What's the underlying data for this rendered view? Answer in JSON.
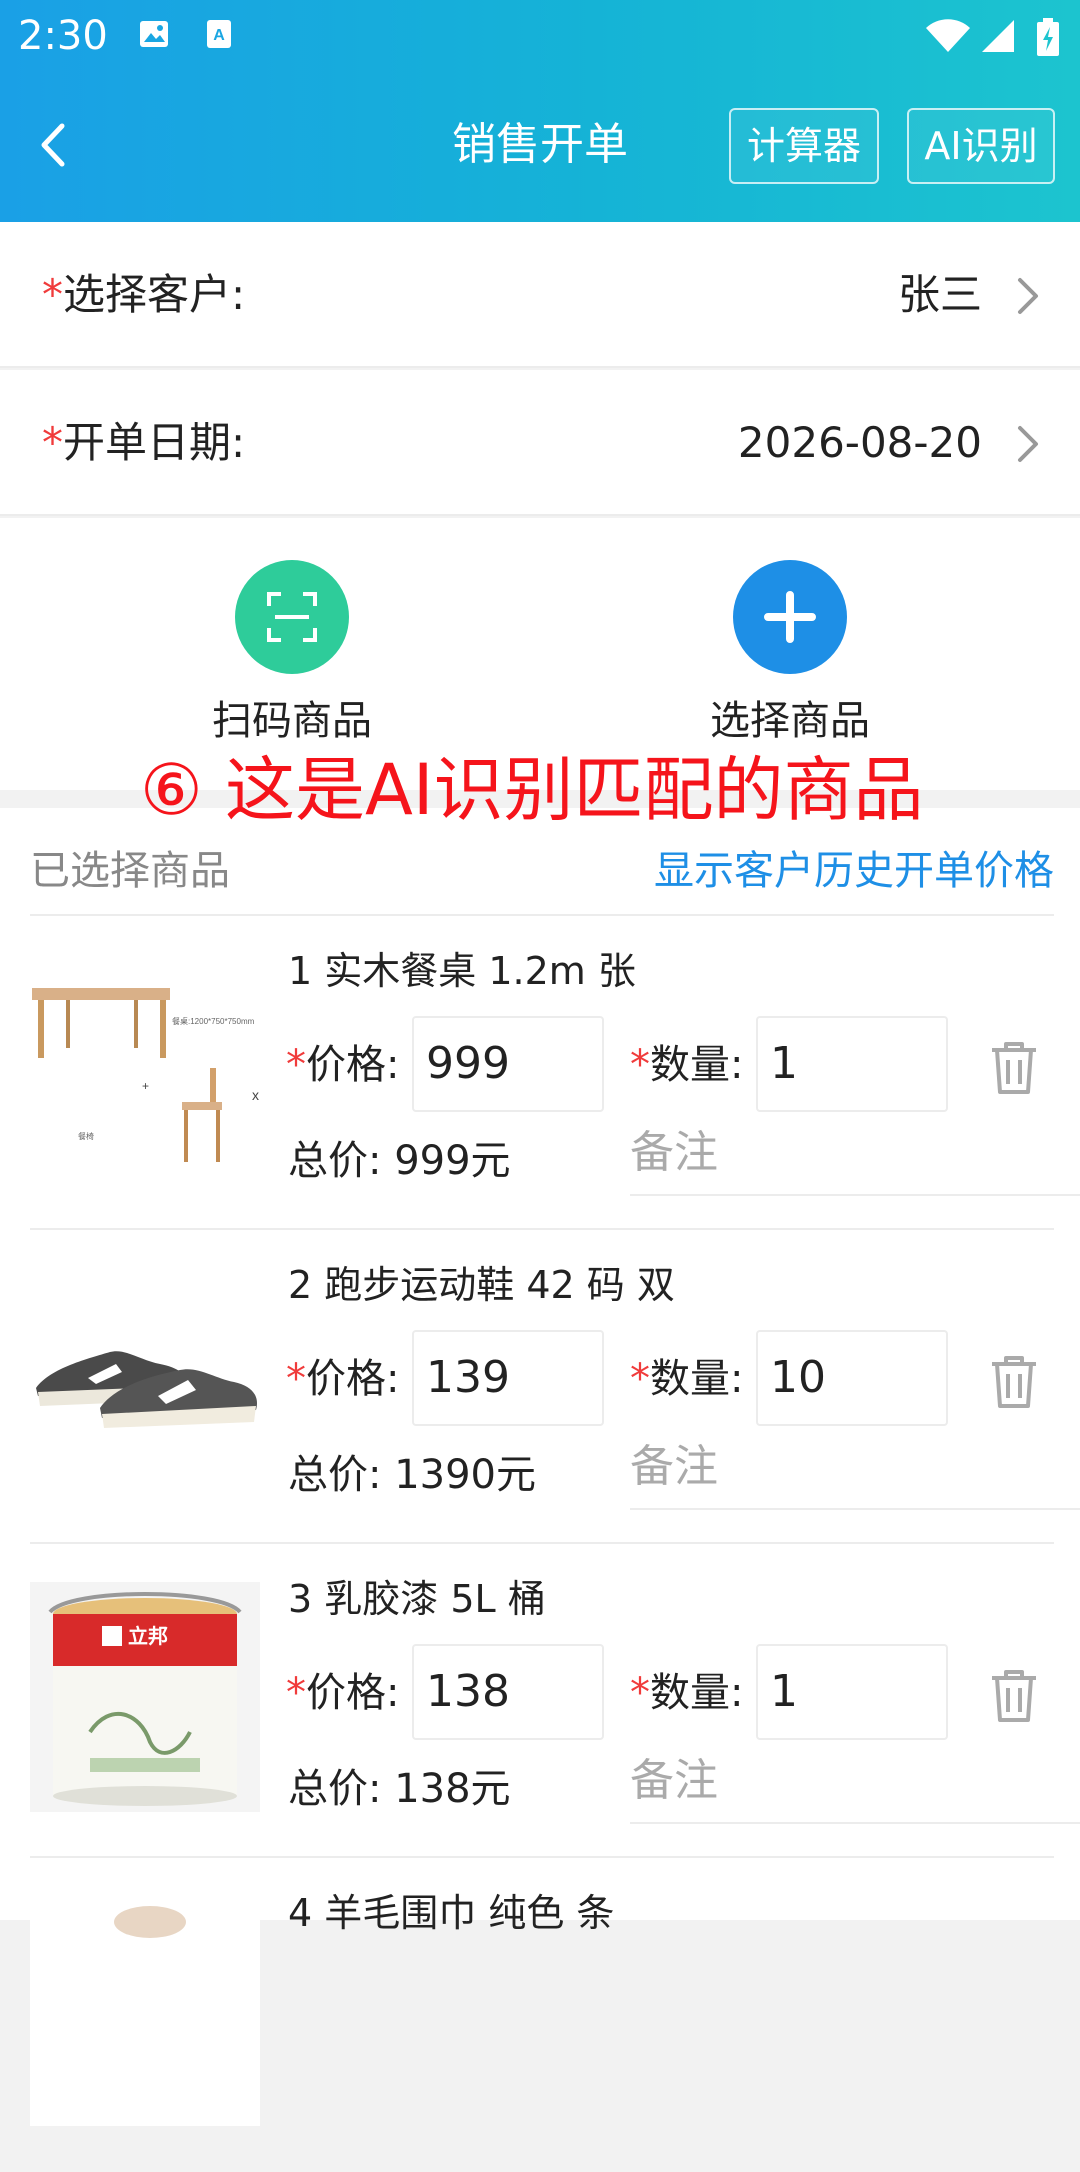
{
  "status_bar": {
    "time": "2:30"
  },
  "nav": {
    "title": "销售开单",
    "calculator_label": "计算器",
    "ai_label": "AI识别"
  },
  "form": {
    "customer": {
      "required_mark": "*",
      "label": "选择客户:",
      "value": "张三"
    },
    "date": {
      "required_mark": "*",
      "label": "开单日期:",
      "value": "2026-08-20"
    }
  },
  "actions": {
    "scan_label": "扫码商品",
    "select_label": "选择商品"
  },
  "overlay_note": "⑥ 这是AI识别匹配的商品",
  "goods": {
    "title": "已选择商品",
    "history_link": "显示客户历史开单价格",
    "price_label": "价格:",
    "qty_label": "数量:",
    "remark_placeholder": "备注",
    "required_mark": "*",
    "items": [
      {
        "name": "1 实木餐桌 1.2m 张",
        "price": "999",
        "qty": "1",
        "total": "总价: 999元",
        "thumb_caption": "餐桌:1200*750*750mm",
        "thumb_caption2": "餐椅"
      },
      {
        "name": "2 跑步运动鞋 42 码 双",
        "price": "139",
        "qty": "10",
        "total": "总价: 1390元"
      },
      {
        "name": "3 乳胶漆 5L 桶",
        "price": "138",
        "qty": "1",
        "total": "总价: 138元",
        "thumb_brand": "立邦"
      },
      {
        "name": "4 羊毛围巾 纯色 条"
      }
    ]
  },
  "colors": {
    "header_start": "#1aa0e6",
    "header_end": "#1cc4cf",
    "scan_green": "#2ecc9a",
    "select_blue": "#1e8fe6",
    "required_red": "#f03b3b",
    "note_red": "#f5141b",
    "link_blue": "#1e8fe6"
  },
  "icons": {
    "back": "chevron-left-icon",
    "scan": "scan-frame-icon",
    "add": "plus-icon",
    "delete": "trash-icon",
    "row_arrow": "chevron-right-icon"
  }
}
